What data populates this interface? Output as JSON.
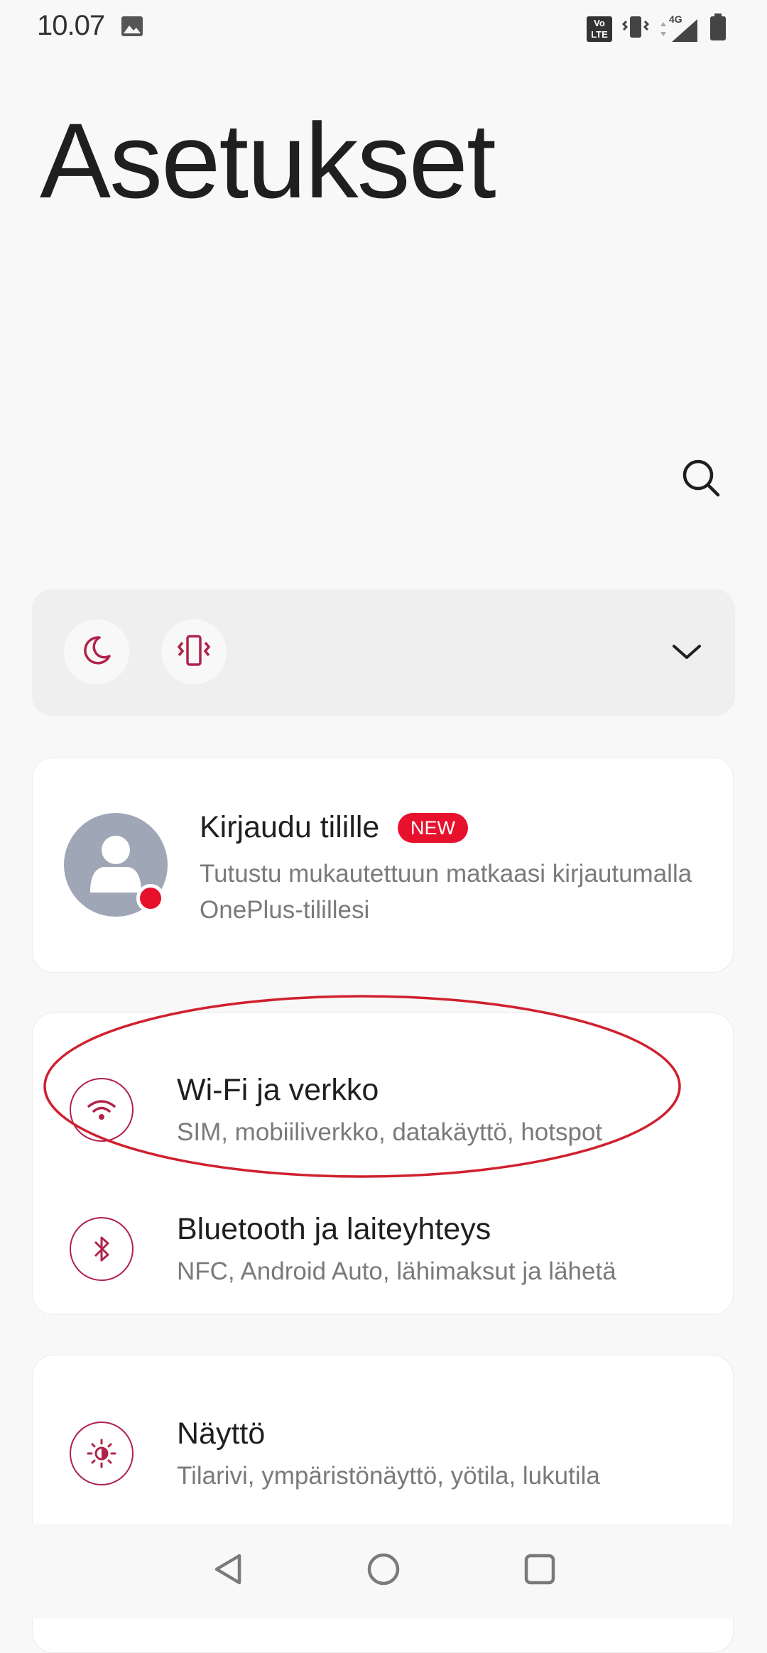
{
  "status_bar": {
    "time": "10.07",
    "icons": [
      "image-icon",
      "volte-icon",
      "vibrate-icon",
      "signal-4g-icon",
      "battery-icon"
    ],
    "volte_label": "Vo LTE",
    "network_label": "4G"
  },
  "page": {
    "title": "Asetukset"
  },
  "search": {
    "icon": "search-icon"
  },
  "quick_settings": {
    "items": [
      {
        "icon": "do-not-disturb-moon-icon"
      },
      {
        "icon": "vibrate-icon"
      }
    ],
    "expand_icon": "chevron-down-icon"
  },
  "account": {
    "title": "Kirjaudu tilille",
    "badge": "NEW",
    "description": "Tutustu mukautettuun matkaasi kirjautumalla OnePlus-tilillesi"
  },
  "settings": {
    "network": [
      {
        "icon": "wifi-icon",
        "title": "Wi-Fi ja verkko",
        "subtitle": "SIM, mobiiliverkko, datakäyttö, hotspot"
      },
      {
        "icon": "bluetooth-icon",
        "title": "Bluetooth ja laiteyhteys",
        "subtitle": "NFC, Android Auto, lähimaksut ja lähetä"
      }
    ],
    "display": [
      {
        "icon": "brightness-icon",
        "title": "Näyttö",
        "subtitle": "Tilarivi, ympäristönäyttö, yötila, lukutila"
      }
    ]
  },
  "colors": {
    "accent": "#b0234a",
    "badge": "#e8112d",
    "highlight": "#d0202e"
  },
  "nav_bar": {
    "icons": [
      "back-icon",
      "home-icon",
      "recents-icon"
    ]
  }
}
